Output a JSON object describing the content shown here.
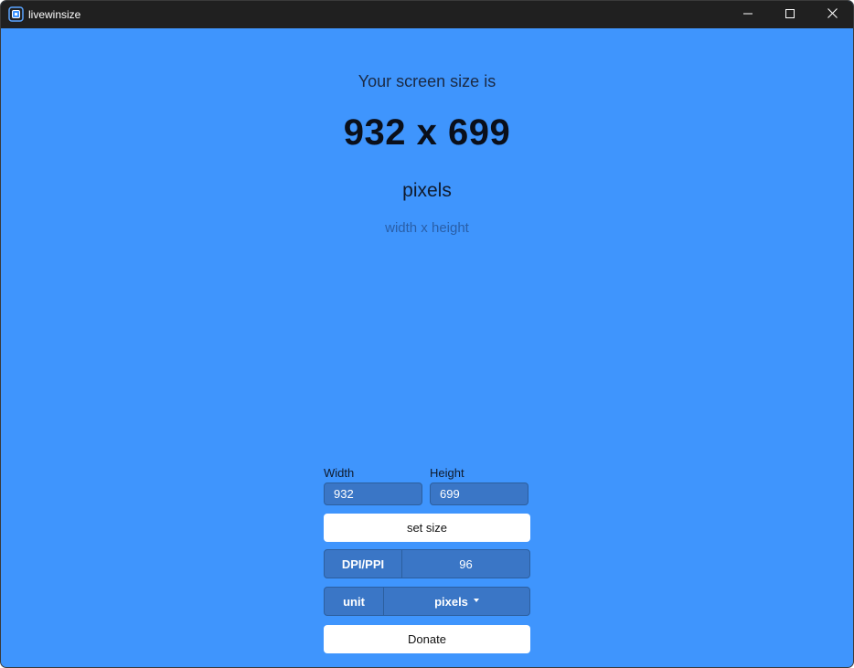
{
  "window": {
    "title": "livewinsize"
  },
  "readout": {
    "lead": "Your screen size is",
    "size": "932 x 699",
    "unit": "pixels",
    "hint": "width x height"
  },
  "form": {
    "width_label": "Width",
    "height_label": "Height",
    "width_value": "932",
    "height_value": "699",
    "set_size_label": "set size",
    "dpi_label": "DPI/PPI",
    "dpi_value": "96",
    "unit_label": "unit",
    "unit_value": "pixels",
    "donate_label": "Donate"
  },
  "colors": {
    "background": "#3f95fd",
    "titlebar": "#202020",
    "control_fill": "#3a76c6"
  },
  "icons": {
    "app": "screen-size-icon",
    "minimize": "minimize-icon",
    "maximize": "maximize-icon",
    "close": "close-icon",
    "dropdown": "caret-down-icon"
  }
}
